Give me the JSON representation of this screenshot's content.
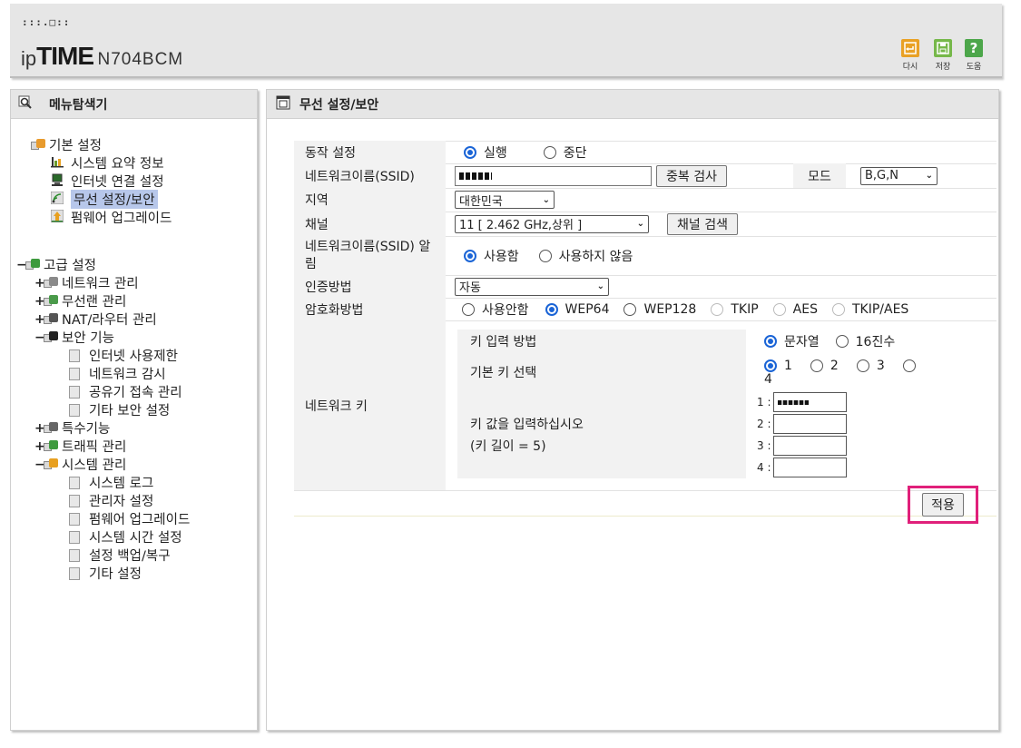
{
  "header": {
    "logo_dots": ":::.□::",
    "logo_ip": "ip",
    "logo_time": "TIME",
    "model": "N704BCM",
    "tools": [
      {
        "label": "다시",
        "icon": "undo-icon",
        "color": "#e9a125"
      },
      {
        "label": "저장",
        "icon": "save-icon",
        "color": "#76b84a"
      },
      {
        "label": "도움",
        "icon": "help-icon",
        "color": "#4ca64a"
      }
    ]
  },
  "left_panel": {
    "title": "메뉴탐색기",
    "basic": {
      "label": "기본 설정",
      "items": [
        "시스템 요약 정보",
        "인터넷 연결 설정",
        "무선 설정/보안",
        "펌웨어 업그레이드"
      ]
    },
    "advanced": {
      "label": "고급 설정",
      "items": [
        "네트워크 관리",
        "무선랜 관리",
        "NAT/라우터 관리",
        "보안 기능",
        "특수기능",
        "트래픽 관리",
        "시스템 관리"
      ],
      "security_sub": [
        "인터넷 사용제한",
        "네트워크 감시",
        "공유기 접속 관리",
        "기타 보안 설정"
      ],
      "system_sub": [
        "시스템 로그",
        "관리자 설정",
        "펌웨어 업그레이드",
        "시스템 시간 설정",
        "설정 백업/복구",
        "기타 설정"
      ]
    }
  },
  "main": {
    "title": "무선 설정/보안",
    "operation": {
      "label": "동작 설정",
      "options": [
        "실행",
        "중단"
      ]
    },
    "ssid": {
      "label": "네트워크이름(SSID)",
      "dup_button": "중복 검사",
      "mode_label": "모드",
      "mode_value": "B,G,N"
    },
    "region": {
      "label": "지역",
      "value": "대한민국"
    },
    "channel": {
      "label": "채널",
      "value": "11 [ 2.462 GHz,상위 ]",
      "search_button": "채널 검색"
    },
    "ssid_broadcast": {
      "label": "네트워크이름(SSID) 알림",
      "options": [
        "사용함",
        "사용하지 않음"
      ]
    },
    "auth": {
      "label": "인증방법",
      "value": "자동"
    },
    "encryption": {
      "label": "암호화방법",
      "options": [
        "사용안함",
        "WEP64",
        "WEP128",
        "TKIP",
        "AES",
        "TKIP/AES"
      ]
    },
    "network_key": {
      "label": "네트워크 키",
      "input_method_label": "키 입력 방법",
      "input_method_options": [
        "문자열",
        "16진수"
      ],
      "default_key_label": "기본 키 선택",
      "default_key_options": [
        "1",
        "2",
        "3",
        "4"
      ],
      "key_value_label": "키 값을 입력하십시오",
      "key_length": "(키 길이 = 5)",
      "key_prefixes": [
        "1 :",
        "2 :",
        "3 :",
        "4 :"
      ]
    },
    "apply_button": "적용"
  }
}
